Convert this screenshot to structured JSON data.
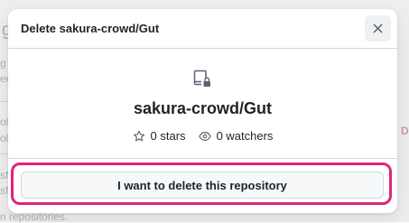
{
  "dialog": {
    "title": "Delete sakura-crowd/Gut",
    "close_label": "×",
    "repo_icon": "repo-locked-icon",
    "repo_name": "sakura-crowd/Gut",
    "stars": "0 stars",
    "watchers": "0 watchers",
    "confirm_label": "I want to delete this repository"
  },
  "background": {
    "fragments": [
      "g",
      "g",
      "ee",
      "ol",
      "ol",
      "D",
      "sf",
      "sf",
      "n repositories."
    ]
  },
  "colors": {
    "highlight": "#e0257a",
    "border": "#d1d9e0",
    "danger": "#d1242f"
  }
}
